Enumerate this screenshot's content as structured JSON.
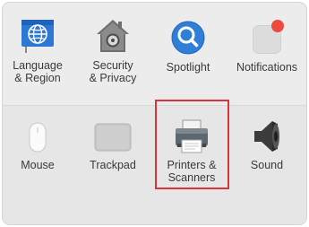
{
  "panes": {
    "language": {
      "label": "Language\n& Region",
      "icon": "globe-flag-icon"
    },
    "security": {
      "label": "Security\n& Privacy",
      "icon": "house-lock-icon"
    },
    "spotlight": {
      "label": "Spotlight",
      "icon": "magnifier-icon"
    },
    "notifications": {
      "label": "Notifications",
      "icon": "notification-badge-icon"
    },
    "mouse": {
      "label": "Mouse",
      "icon": "mouse-icon"
    },
    "trackpad": {
      "label": "Trackpad",
      "icon": "trackpad-icon"
    },
    "printers": {
      "label": "Printers &\nScanners",
      "icon": "printer-icon"
    },
    "sound": {
      "label": "Sound",
      "icon": "speaker-icon"
    }
  },
  "colors": {
    "highlight": "#d8343a",
    "spotlight_blue": "#2f7fd6",
    "notification_red": "#ee4a3f"
  }
}
